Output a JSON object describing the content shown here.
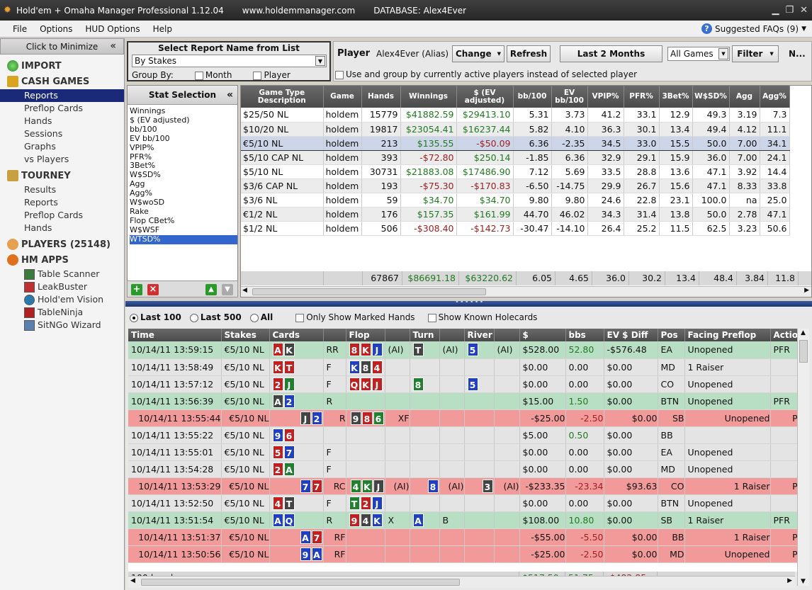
{
  "window": {
    "title": "Hold'em + Omaha Manager Professional 1.12.04",
    "url": "www.holdemmanager.com",
    "database": "DATABASE: Alex4Ever"
  },
  "menu": [
    "File",
    "Options",
    "HUD Options",
    "Help"
  ],
  "faq": {
    "label": "Suggested FAQs",
    "count": "(9)"
  },
  "sidebar": {
    "minimize": "Click to Minimize",
    "import": "IMPORT",
    "cash": "CASH GAMES",
    "cash_items": [
      "Reports",
      "Preflop Cards",
      "Hands",
      "Sessions",
      "Graphs",
      "vs Players"
    ],
    "tourney": "TOURNEY",
    "tourney_items": [
      "Results",
      "Reports",
      "Preflop Cards",
      "Hands"
    ],
    "players": "PLAYERS (25148)",
    "apps": "HM APPS",
    "app_items": [
      "Table Scanner",
      "LeakBuster",
      "Hold'em Vision",
      "TableNinja",
      "SitNGo Wizard"
    ]
  },
  "report": {
    "heading": "Select Report Name from List",
    "selected": "By Stakes",
    "group_by": "Group By:",
    "month": "Month",
    "player": "Player"
  },
  "playerbar": {
    "label": "Player",
    "name": "Alex4Ever (Alias)",
    "change": "Change",
    "refresh": "Refresh",
    "period": "Last  2 Months",
    "games": "All Games",
    "filter": "Filter",
    "extra": "N...",
    "use_group": "Use and group by currently active players instead of selected player"
  },
  "stat_selection": {
    "title": "Stat Selection",
    "items": [
      "Winnings",
      "$ (EV adjusted)",
      "bb/100",
      "EV bb/100",
      "VPIP%",
      "PFR%",
      "3Bet%",
      "W$SD%",
      "Agg",
      "Agg%",
      "W$woSD",
      "Rake",
      "Flop CBet%",
      "W$WSF",
      "WTSD%"
    ],
    "selected_index": 14
  },
  "stakes_table": {
    "columns": [
      "Game Type Description",
      "Game",
      "Hands",
      "Winnings",
      "$ (EV adjusted)",
      "bb/100",
      "EV bb/100",
      "VPIP%",
      "PFR%",
      "3Bet%",
      "W$SD%",
      "Agg",
      "Agg%"
    ],
    "rows": [
      [
        "$25/50 NL",
        "holdem",
        "15779",
        "$41882.59",
        "$29413.10",
        "5.31",
        "3.73",
        "41.2",
        "33.1",
        "12.9",
        "49.3",
        "3.19",
        "7.3"
      ],
      [
        "$10/20 NL",
        "holdem",
        "19817",
        "$23054.41",
        "$16237.44",
        "5.82",
        "4.10",
        "36.3",
        "30.1",
        "13.4",
        "49.4",
        "4.12",
        "11.1"
      ],
      [
        "€5/10 NL",
        "holdem",
        "213",
        "$135.55",
        "-$50.09",
        "6.36",
        "-2.35",
        "34.5",
        "33.0",
        "15.5",
        "50.0",
        "7.00",
        "34.1"
      ],
      [
        "$5/10 CAP NL",
        "holdem",
        "393",
        "-$72.80",
        "$250.14",
        "-1.85",
        "6.36",
        "32.9",
        "29.1",
        "15.9",
        "36.0",
        "7.00",
        "24.1"
      ],
      [
        "$5/10 NL",
        "holdem",
        "30731",
        "$21883.08",
        "$17486.90",
        "7.12",
        "5.69",
        "33.5",
        "28.8",
        "13.6",
        "47.1",
        "3.92",
        "14.4"
      ],
      [
        "$3/6 CAP NL",
        "holdem",
        "193",
        "-$75.30",
        "-$170.83",
        "-6.50",
        "-14.75",
        "29.9",
        "26.7",
        "15.6",
        "47.1",
        "8.33",
        "33.8"
      ],
      [
        "$3/6 NL",
        "holdem",
        "59",
        "$34.70",
        "$34.70",
        "9.80",
        "9.80",
        "24.6",
        "22.8",
        "23.1",
        "100.0",
        "na",
        "25.0"
      ],
      [
        "€1/2 NL",
        "holdem",
        "176",
        "$157.35",
        "$161.99",
        "44.70",
        "46.02",
        "34.3",
        "31.4",
        "13.8",
        "50.0",
        "2.78",
        "47.1"
      ],
      [
        "$1/2 NL",
        "holdem",
        "506",
        "-$308.40",
        "-$142.73",
        "-30.47",
        "-14.10",
        "26.4",
        "25.2",
        "11.5",
        "62.5",
        "3.23",
        "50.6"
      ]
    ],
    "highlight_index": 2,
    "totals": [
      "",
      "",
      "67867",
      "$86691.18",
      "$63220.62",
      "6.05",
      "4.65",
      "36.0",
      "30.2",
      "13.4",
      "48.4",
      "3.84",
      "11.8"
    ]
  },
  "hands_options": {
    "last100": "Last 100",
    "last500": "Last 500",
    "all": "All",
    "marked": "Only Show Marked Hands",
    "holecards": "Show Known Holecards"
  },
  "hands_table": {
    "columns": [
      "Time",
      "Stakes",
      "Cards",
      "",
      "Flop",
      "",
      "Turn",
      "",
      "River",
      "",
      "$",
      "bbs",
      "EV $ Diff",
      "Pos",
      "Facing Preflop",
      "Action"
    ],
    "rows": [
      {
        "time": "10/14/11 13:59:15",
        "stakes": "€5/10 NL",
        "cards": [
          [
            "A",
            "h"
          ],
          [
            "K",
            "s"
          ]
        ],
        "pa": "RR",
        "flop": [
          [
            "8",
            "h"
          ],
          [
            "K",
            "h"
          ],
          [
            "J",
            "d"
          ]
        ],
        "fa": "(AI)",
        "turn": [
          [
            "T",
            "s"
          ]
        ],
        "ta": "(AI)",
        "river": [
          [
            "5",
            "d"
          ]
        ],
        "ra": "(AI)",
        "amt": "$528.00",
        "bbs": "52.80",
        "ev": "-$576.48",
        "pos": "EA",
        "facing": "Unopened",
        "action": "PFR",
        "c": "g"
      },
      {
        "time": "10/14/11 13:58:49",
        "stakes": "€5/10 NL",
        "cards": [
          [
            "K",
            "h"
          ],
          [
            "T",
            "h"
          ]
        ],
        "pa": "F",
        "flop": [
          [
            "K",
            "d"
          ],
          [
            "8",
            "s"
          ],
          [
            "4",
            "h"
          ]
        ],
        "fa": "",
        "turn": [],
        "ta": "",
        "river": [],
        "ra": "",
        "amt": "$0.00",
        "bbs": "0.00",
        "ev": "$0.00",
        "pos": "MD",
        "facing": "1 Raiser",
        "action": "",
        "c": "n"
      },
      {
        "time": "10/14/11 13:57:12",
        "stakes": "€5/10 NL",
        "cards": [
          [
            "2",
            "h"
          ],
          [
            "J",
            "c"
          ]
        ],
        "pa": "F",
        "flop": [
          [
            "Q",
            "h"
          ],
          [
            "K",
            "h"
          ],
          [
            "J",
            "h"
          ]
        ],
        "fa": "",
        "turn": [
          [
            "8",
            "c"
          ]
        ],
        "ta": "",
        "river": [
          [
            "5",
            "d"
          ]
        ],
        "ra": "",
        "amt": "$0.00",
        "bbs": "0.00",
        "ev": "$0.00",
        "pos": "CO",
        "facing": "Unopened",
        "action": "",
        "c": "n"
      },
      {
        "time": "10/14/11 13:56:39",
        "stakes": "€5/10 NL",
        "cards": [
          [
            "A",
            "s"
          ],
          [
            "2",
            "d"
          ]
        ],
        "pa": "R",
        "flop": [],
        "fa": "",
        "turn": [],
        "ta": "",
        "river": [],
        "ra": "",
        "amt": "$15.00",
        "bbs": "1.50",
        "ev": "$0.00",
        "pos": "BTN",
        "facing": "Unopened",
        "action": "PFR",
        "c": "g"
      },
      {
        "time": "10/14/11 13:55:44",
        "stakes": "€5/10 NL",
        "cards": [
          [
            "J",
            "s"
          ],
          [
            "2",
            "d"
          ]
        ],
        "pa": "R",
        "flop": [
          [
            "9",
            "s"
          ],
          [
            "8",
            "h"
          ],
          [
            "6",
            "c"
          ]
        ],
        "fa": "XF",
        "turn": [],
        "ta": "",
        "river": [],
        "ra": "",
        "amt": "-$25.00",
        "bbs": "-2.50",
        "ev": "$0.00",
        "pos": "SB",
        "facing": "Unopened",
        "action": "PFR",
        "c": "r"
      },
      {
        "time": "10/14/11 13:55:22",
        "stakes": "€5/10 NL",
        "cards": [
          [
            "9",
            "d"
          ],
          [
            "6",
            "h"
          ]
        ],
        "pa": "",
        "flop": [],
        "fa": "",
        "turn": [],
        "ta": "",
        "river": [],
        "ra": "",
        "amt": "$5.00",
        "bbs": "0.50",
        "ev": "$0.00",
        "pos": "BB",
        "facing": "",
        "action": "",
        "c": "n"
      },
      {
        "time": "10/14/11 13:55:01",
        "stakes": "€5/10 NL",
        "cards": [
          [
            "5",
            "h"
          ],
          [
            "7",
            "d"
          ]
        ],
        "pa": "F",
        "flop": [],
        "fa": "",
        "turn": [],
        "ta": "",
        "river": [],
        "ra": "",
        "amt": "$0.00",
        "bbs": "0.00",
        "ev": "$0.00",
        "pos": "EA",
        "facing": "Unopened",
        "action": "",
        "c": "n"
      },
      {
        "time": "10/14/11 13:54:28",
        "stakes": "€5/10 NL",
        "cards": [
          [
            "2",
            "h"
          ],
          [
            "A",
            "c"
          ]
        ],
        "pa": "F",
        "flop": [],
        "fa": "",
        "turn": [],
        "ta": "",
        "river": [],
        "ra": "",
        "amt": "$0.00",
        "bbs": "0.00",
        "ev": "$0.00",
        "pos": "MD",
        "facing": "Unopened",
        "action": "",
        "c": "n"
      },
      {
        "time": "10/14/11 13:53:29",
        "stakes": "€5/10 NL",
        "cards": [
          [
            "7",
            "d"
          ],
          [
            "7",
            "h"
          ]
        ],
        "pa": "RC",
        "flop": [
          [
            "4",
            "c"
          ],
          [
            "K",
            "c"
          ],
          [
            "J",
            "s"
          ]
        ],
        "fa": "(AI)",
        "turn": [
          [
            "8",
            "d"
          ]
        ],
        "ta": "(AI)",
        "river": [
          [
            "3",
            "s"
          ]
        ],
        "ra": "(AI)",
        "amt": "-$233.35",
        "bbs": "-23.34",
        "ev": "$93.63",
        "pos": "CO",
        "facing": "1 Raiser",
        "action": "PFR",
        "c": "r"
      },
      {
        "time": "10/14/11 13:52:50",
        "stakes": "€5/10 NL",
        "cards": [
          [
            "4",
            "h"
          ],
          [
            "T",
            "s"
          ]
        ],
        "pa": "F",
        "flop": [
          [
            "T",
            "c"
          ],
          [
            "2",
            "h"
          ],
          [
            "J",
            "d"
          ]
        ],
        "fa": "",
        "turn": [],
        "ta": "",
        "river": [],
        "ra": "",
        "amt": "$0.00",
        "bbs": "0.00",
        "ev": "$0.00",
        "pos": "BTN",
        "facing": "Unopened",
        "action": "",
        "c": "n"
      },
      {
        "time": "10/14/11 13:51:54",
        "stakes": "€5/10 NL",
        "cards": [
          [
            "A",
            "d"
          ],
          [
            "Q",
            "d"
          ]
        ],
        "pa": "R",
        "flop": [
          [
            "9",
            "h"
          ],
          [
            "4",
            "s"
          ],
          [
            "K",
            "d"
          ]
        ],
        "fa": "X",
        "turn": [
          [
            "A",
            "d"
          ]
        ],
        "ta": "B",
        "river": [],
        "ra": "",
        "amt": "$108.00",
        "bbs": "10.80",
        "ev": "$0.00",
        "pos": "SB",
        "facing": "1 Raiser",
        "action": "PFR",
        "c": "g"
      },
      {
        "time": "10/14/11 13:51:37",
        "stakes": "€5/10 NL",
        "cards": [
          [
            "A",
            "d"
          ],
          [
            "7",
            "h"
          ]
        ],
        "pa": "RF",
        "flop": [],
        "fa": "",
        "turn": [],
        "ta": "",
        "river": [],
        "ra": "",
        "amt": "-$55.00",
        "bbs": "-5.50",
        "ev": "$0.00",
        "pos": "BB",
        "facing": "1 Raiser",
        "action": "PFR",
        "c": "r"
      },
      {
        "time": "10/14/11 13:50:56",
        "stakes": "€5/10 NL",
        "cards": [
          [
            "9",
            "d"
          ],
          [
            "A",
            "d"
          ]
        ],
        "pa": "RF",
        "flop": [],
        "fa": "",
        "turn": [],
        "ta": "",
        "river": [],
        "ra": "",
        "amt": "-$25.00",
        "bbs": "-2.50",
        "ev": "$0.00",
        "pos": "MD",
        "facing": "Unopened",
        "action": "PFR",
        "c": "r"
      }
    ],
    "footer": {
      "count": "100 hands",
      "amt": "$517.50",
      "bbs": "51.75",
      "ev": "-$482.85"
    }
  },
  "colors": {
    "selected_nav": "#1a2a78",
    "green_row": "#b8dfc4",
    "red_row": "#f29a9a",
    "header": "#555555"
  }
}
